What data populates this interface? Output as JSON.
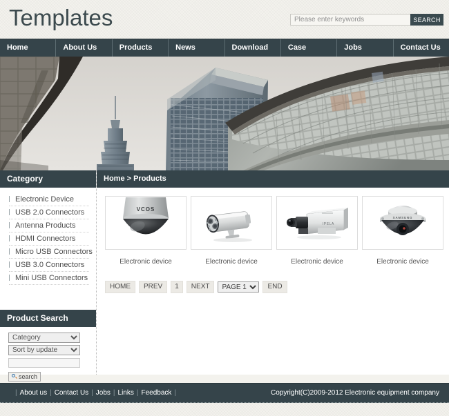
{
  "header": {
    "logo": "Templates",
    "search": {
      "placeholder": "Please enter keywords",
      "value": "",
      "button_label": "SEARCH"
    }
  },
  "nav": {
    "items": [
      {
        "label": "Home"
      },
      {
        "label": "About Us"
      },
      {
        "label": "Products"
      },
      {
        "label": "News"
      },
      {
        "label": "Download"
      },
      {
        "label": "Case"
      },
      {
        "label": "Jobs"
      },
      {
        "label": "Contact Us"
      }
    ]
  },
  "banner": {
    "alt": "city-buildings-banner"
  },
  "sidebar": {
    "category": {
      "title": "Category",
      "items": [
        {
          "label": "Electronic Device"
        },
        {
          "label": "USB 2.0 Connectors"
        },
        {
          "label": "Antenna Products"
        },
        {
          "label": "HDMI Connectors"
        },
        {
          "label": "Micro USB Connectors"
        },
        {
          "label": "USB 3.0 Connectors"
        },
        {
          "label": "Mini USB Connectors"
        }
      ]
    },
    "product_search": {
      "title": "Product Search",
      "category_select": {
        "value": "Category",
        "options": [
          "Category"
        ]
      },
      "sort_select": {
        "value": "Sort by update",
        "options": [
          "Sort by update"
        ]
      },
      "keyword": {
        "value": "",
        "placeholder": ""
      },
      "search_button": "search"
    }
  },
  "main": {
    "breadcrumb": "Home > Products",
    "products": [
      {
        "caption": "Electronic device",
        "image": "dome-camera-vcos"
      },
      {
        "caption": "Electronic device",
        "image": "bullet-ir-camera"
      },
      {
        "caption": "Electronic device",
        "image": "box-camera-ipela"
      },
      {
        "caption": "Electronic device",
        "image": "dome-camera-samsung"
      }
    ],
    "pagination": {
      "home": "HOME",
      "prev": "PREV",
      "current_page": "1",
      "next": "NEXT",
      "page_select": {
        "value": "PAGE 1",
        "options": [
          "PAGE 1"
        ]
      },
      "end": "END"
    }
  },
  "footer": {
    "links": [
      {
        "label": "About us"
      },
      {
        "label": "Contact Us"
      },
      {
        "label": "Jobs"
      },
      {
        "label": "Links"
      },
      {
        "label": "Feedback"
      }
    ],
    "copyright": "Copyright(C)2009-2012 Electronic equipment company"
  },
  "colors": {
    "dark": "#35444a",
    "page_bg": "#f3f2ed",
    "content_bg": "#ffffff",
    "logo_text": "#3c4a4e"
  }
}
